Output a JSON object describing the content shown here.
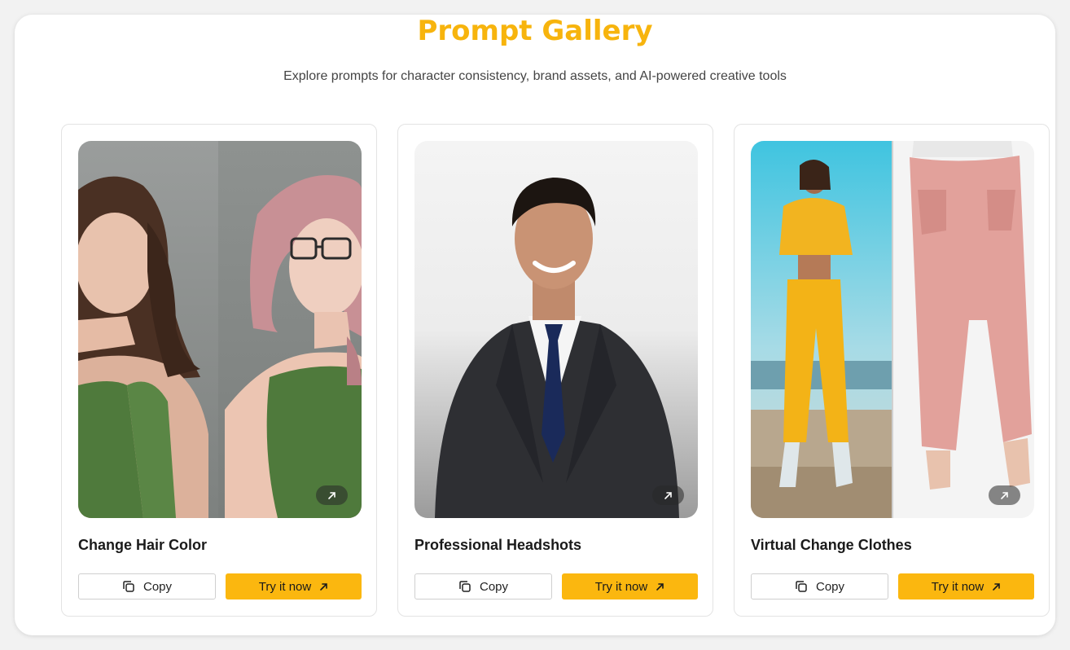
{
  "header": {
    "title": "Prompt Gallery",
    "subtitle": "Explore prompts for character consistency, brand assets, and AI-powered creative tools"
  },
  "cards": [
    {
      "title": "Change Hair Color",
      "copy_label": "Copy",
      "try_label": "Try it now",
      "image_icon": "image-before-after",
      "open_icon": "arrow-up-right-icon"
    },
    {
      "title": "Professional Headshots",
      "copy_label": "Copy",
      "try_label": "Try it now",
      "image_icon": "image-headshot",
      "open_icon": "arrow-up-right-icon"
    },
    {
      "title": "Virtual Change Clothes",
      "copy_label": "Copy",
      "try_label": "Try it now",
      "image_icon": "image-outfit-swap",
      "open_icon": "arrow-up-right-icon"
    }
  ],
  "colors": {
    "accent": "#fbb70f",
    "title": "#f7b40d",
    "card_border": "#e3e3e3"
  }
}
